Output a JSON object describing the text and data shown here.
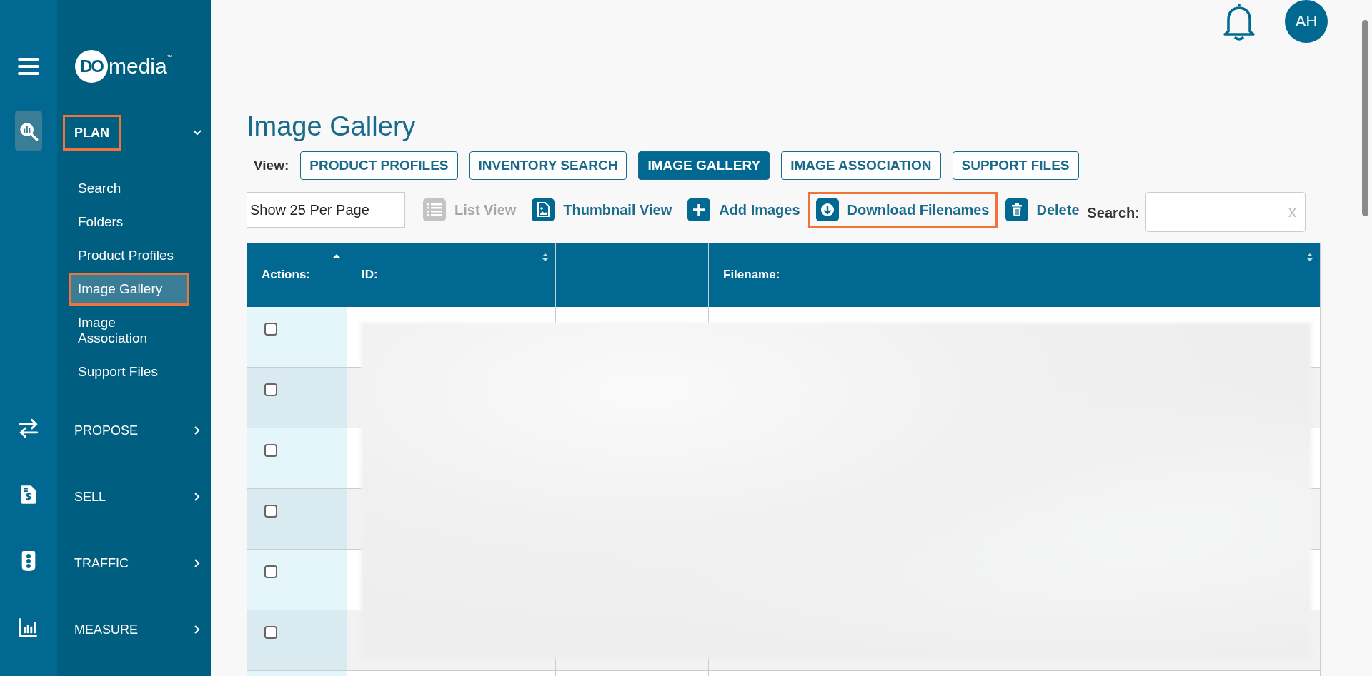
{
  "sidebar": {
    "logo": {
      "badge": "DO",
      "text": "media",
      "mark": "™"
    },
    "sections": [
      {
        "label": "PLAN",
        "kind": "plan",
        "selected": true,
        "expanded": true,
        "highlighted": true,
        "items": [
          {
            "label": "Search",
            "selected": false,
            "highlighted": false
          },
          {
            "label": "Folders",
            "selected": false,
            "highlighted": false
          },
          {
            "label": "Product Profiles",
            "selected": false,
            "highlighted": false
          },
          {
            "label": "Image Gallery",
            "selected": true,
            "highlighted": true
          },
          {
            "label": "Image Association",
            "selected": false,
            "highlighted": false
          },
          {
            "label": "Support Files",
            "selected": false,
            "highlighted": false
          }
        ]
      },
      {
        "label": "PROPOSE",
        "kind": "propose",
        "selected": false,
        "expanded": false,
        "highlighted": false
      },
      {
        "label": "SELL",
        "kind": "sell",
        "selected": false,
        "expanded": false,
        "highlighted": false
      },
      {
        "label": "TRAFFIC",
        "kind": "traffic",
        "selected": false,
        "expanded": false,
        "highlighted": false
      },
      {
        "label": "MEASURE",
        "kind": "measure",
        "selected": false,
        "expanded": false,
        "highlighted": false
      }
    ]
  },
  "header": {
    "avatar": "AH"
  },
  "page": {
    "title": "Image Gallery",
    "view_label": "View:",
    "views": [
      {
        "label": "PRODUCT PROFILES",
        "selected": false
      },
      {
        "label": "INVENTORY SEARCH",
        "selected": false
      },
      {
        "label": "IMAGE GALLERY",
        "selected": true
      },
      {
        "label": "IMAGE ASSOCIATION",
        "selected": false
      },
      {
        "label": "SUPPORT FILES",
        "selected": false
      }
    ]
  },
  "toolbar": {
    "page_size": "Show 25 Per Page",
    "actions": [
      {
        "label": "List View",
        "kind": "list",
        "disabled": true,
        "highlighted": false
      },
      {
        "label": "Thumbnail View",
        "kind": "thumbnail",
        "disabled": false,
        "highlighted": false
      },
      {
        "label": "Add Images",
        "kind": "add",
        "disabled": false,
        "highlighted": false
      },
      {
        "label": "Download Filenames",
        "kind": "download",
        "disabled": false,
        "highlighted": true
      },
      {
        "label": "Delete",
        "kind": "delete",
        "disabled": false,
        "highlighted": false
      }
    ],
    "search_label": "Search:",
    "search_clear": "x"
  },
  "table": {
    "columns": [
      {
        "label": "Actions:",
        "kind": "sorted"
      },
      {
        "label": "ID:",
        "kind": "sortable"
      },
      {
        "kind": "plain"
      },
      {
        "label": "Filename:",
        "kind": "sortable"
      }
    ],
    "rows": [
      {
        "checked": false
      },
      {
        "checked": false
      },
      {
        "checked": false
      },
      {
        "checked": false
      },
      {
        "checked": false
      },
      {
        "checked": false
      }
    ]
  }
}
